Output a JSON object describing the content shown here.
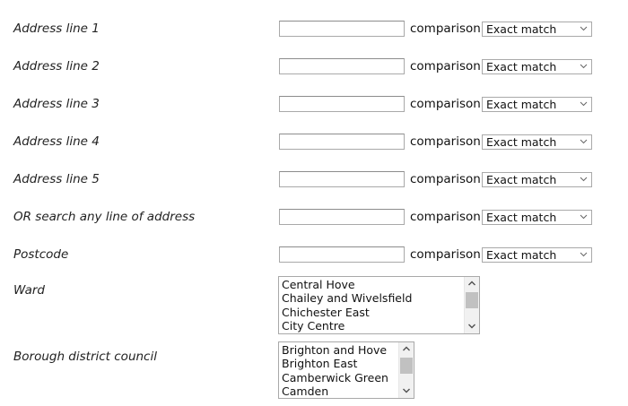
{
  "form": {
    "comparison_label": "comparison",
    "address_fields": [
      {
        "label": "Address line 1",
        "value": "",
        "comparison": "Exact match"
      },
      {
        "label": "Address line 2",
        "value": "",
        "comparison": "Exact match"
      },
      {
        "label": "Address line 3",
        "value": "",
        "comparison": "Exact match"
      },
      {
        "label": "Address line 4",
        "value": "",
        "comparison": "Exact match"
      },
      {
        "label": "Address line 5",
        "value": "",
        "comparison": "Exact match"
      },
      {
        "label": "OR search any line of address",
        "value": "",
        "comparison": "Exact match"
      },
      {
        "label": "Postcode",
        "value": "",
        "comparison": "Exact match"
      }
    ],
    "ward": {
      "label": "Ward",
      "options": [
        "Central Hove",
        "Chailey and Wivelsfield",
        "Chichester East",
        "City Centre"
      ]
    },
    "borough": {
      "label": "Borough district council",
      "options": [
        "Brighton and Hove",
        "Brighton East",
        "Camberwick Green",
        "Camden"
      ]
    }
  },
  "icons": {
    "dropdown": "chevron-down-icon",
    "scroll_up": "arrow-up-icon",
    "scroll_down": "arrow-down-icon"
  },
  "colors": {
    "text": "#222222",
    "border": "#a9a9a9",
    "scrollbar_track": "#f1f1f1",
    "scrollbar_thumb": "#c1c1c1"
  }
}
